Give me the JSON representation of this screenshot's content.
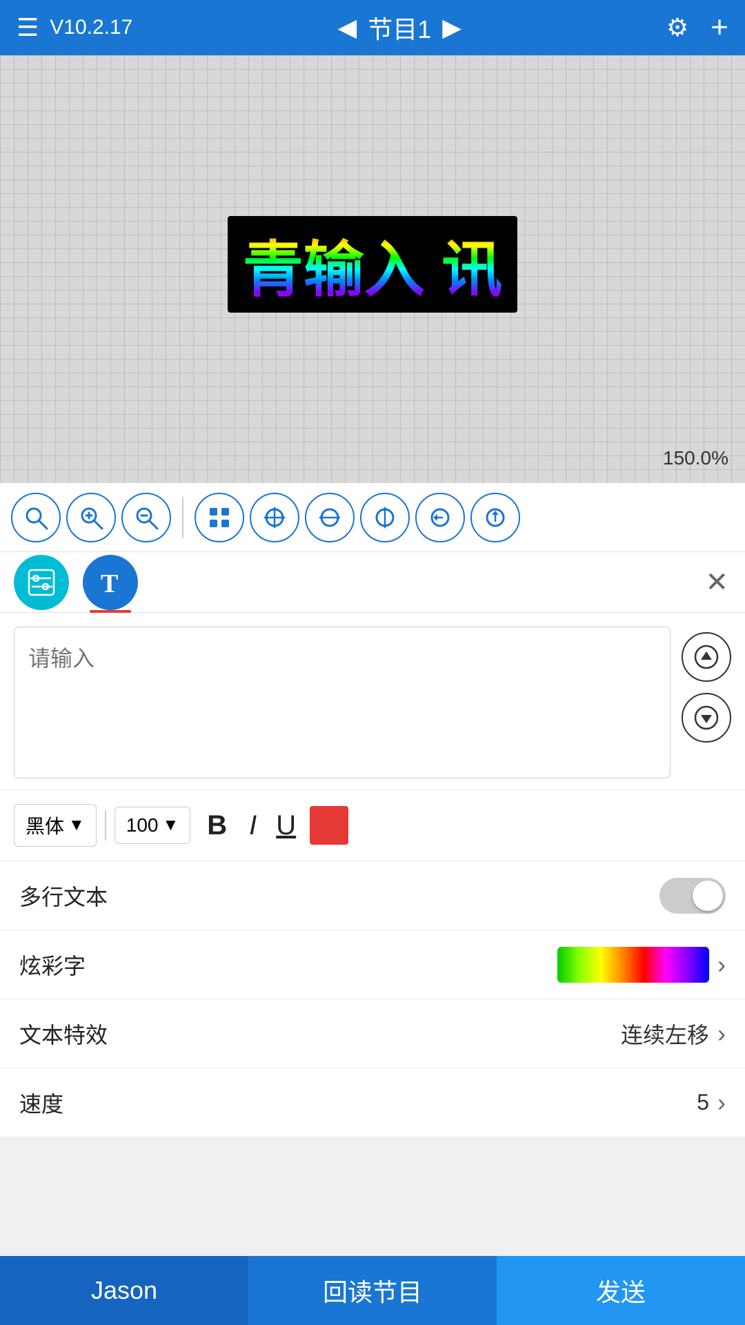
{
  "header": {
    "menu_label": "☰",
    "version": "V10.2.17",
    "nav_left": "◀",
    "nav_title": "节目1",
    "nav_right": "▶",
    "gear": "⚙",
    "plus": "+"
  },
  "canvas": {
    "zoom": "150.0%",
    "led_text": "青输入 讯"
  },
  "toolbar": {
    "tools": [
      {
        "name": "search",
        "label": "🔍"
      },
      {
        "name": "zoom-in",
        "label": "⊕"
      },
      {
        "name": "zoom-out",
        "label": "⊖"
      },
      {
        "name": "grid",
        "label": "⊞"
      },
      {
        "name": "move",
        "label": "✛"
      },
      {
        "name": "h-resize",
        "label": "↔"
      },
      {
        "name": "v-resize",
        "label": "↕"
      },
      {
        "name": "back",
        "label": "←"
      },
      {
        "name": "up",
        "label": "↑"
      }
    ]
  },
  "tabs": [
    {
      "id": "settings",
      "active": false
    },
    {
      "id": "text",
      "active": true
    }
  ],
  "text_editor": {
    "placeholder": "请输入"
  },
  "font_controls": {
    "font_name": "黑体",
    "font_size": "100",
    "bold": "B",
    "italic": "I",
    "underline": "U"
  },
  "settings": [
    {
      "id": "multiline",
      "label": "多行文本",
      "type": "toggle",
      "value": false
    },
    {
      "id": "colorful",
      "label": "炫彩字",
      "type": "rainbow",
      "value": ""
    },
    {
      "id": "effect",
      "label": "文本特效",
      "type": "text-value",
      "value": "连续左移"
    },
    {
      "id": "speed",
      "label": "速度",
      "type": "number-value",
      "value": "5"
    }
  ],
  "bottom_buttons": [
    {
      "id": "jason",
      "label": "Jason"
    },
    {
      "id": "reload",
      "label": "回读节目"
    },
    {
      "id": "send",
      "label": "发送"
    }
  ]
}
